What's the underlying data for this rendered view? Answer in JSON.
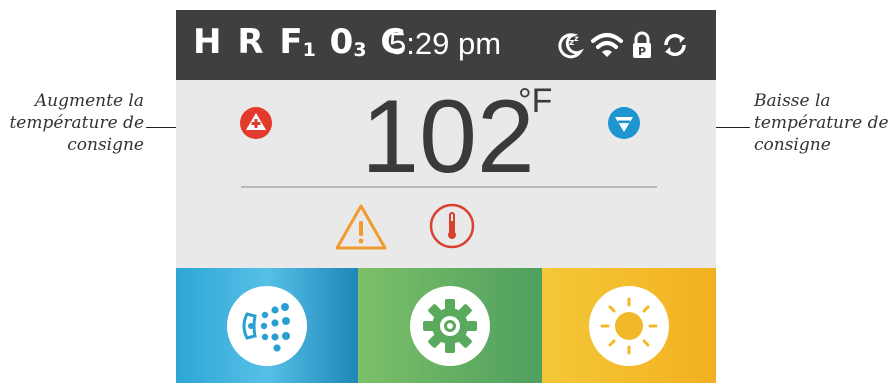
{
  "callouts": {
    "left": [
      "Augmente la",
      "température de",
      "consigne"
    ],
    "right": [
      "Baisse la",
      "température de",
      "consigne"
    ]
  },
  "status_bar": {
    "code_letters": [
      "H",
      "R",
      "F",
      "0",
      "C"
    ],
    "code_subscripts": [
      "1",
      "3"
    ],
    "time": "5:29 pm",
    "icons": [
      "sleep-moon-icon",
      "wifi-icon",
      "lock-p-icon",
      "refresh-icon"
    ]
  },
  "temperature": {
    "value": "102",
    "unit": "°F"
  },
  "buttons": {
    "increase_icon": "plus-icon",
    "decrease_icon": "triangle-down-icon"
  },
  "alerts": [
    "warning-icon",
    "thermometer-icon"
  ],
  "tiles": [
    {
      "name": "jets",
      "icon": "jets-icon"
    },
    {
      "name": "settings",
      "icon": "gear-icon"
    },
    {
      "name": "light",
      "icon": "sun-icon"
    }
  ],
  "colors": {
    "status_bar": "#3f3f3f",
    "screen_bg": "#e9e9e9",
    "increase": "#e23b2e",
    "decrease": "#1e95cf",
    "warning": "#f29a2e",
    "temp_alert": "#d9412f",
    "jets_tile": "#2ea6d6",
    "settings_tile": "#6bb364",
    "light_tile": "#f3b82a"
  }
}
